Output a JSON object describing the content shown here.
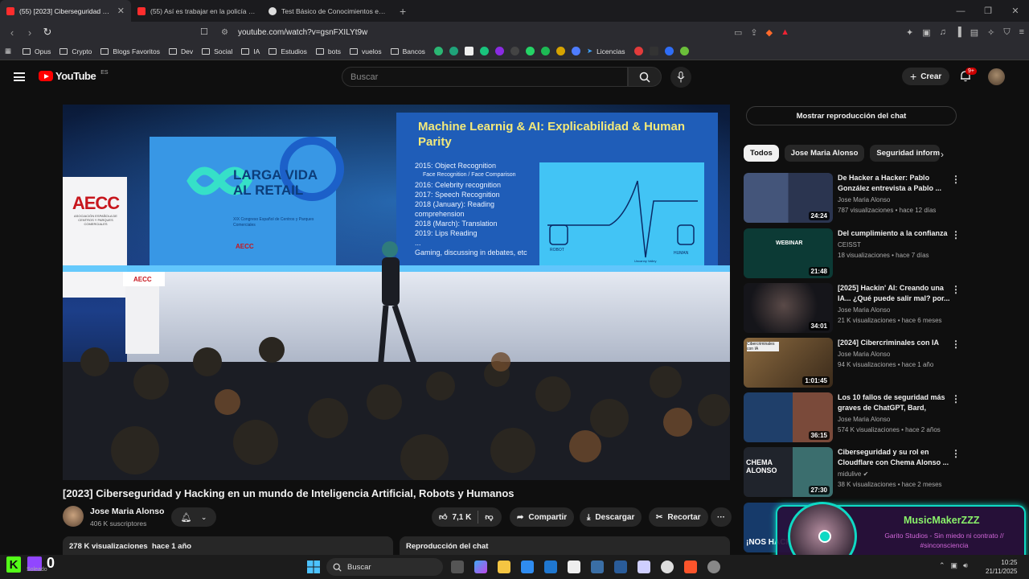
{
  "browser": {
    "tabs": [
      {
        "title": "(55) [2023] Ciberseguridad y Hacking",
        "favicon_color": "#ff2d2d",
        "active": true
      },
      {
        "title": "(55) Así es trabajar en la policía com",
        "favicon_color": "#ff2d2d",
        "active": false
      },
      {
        "title": "Test Básico de Conocimientos en Inst",
        "favicon_color": "#dddddd",
        "active": false
      }
    ],
    "url": "youtube.com/watch?v=gsnFXILYt9w",
    "bookmarks": [
      "Opus",
      "Crypto",
      "Blogs Favoritos",
      "Dev",
      "Social",
      "IA",
      "Estudios",
      "bots",
      "vuelos",
      "Bancos",
      "Licencias"
    ]
  },
  "youtube": {
    "logo": "YouTube",
    "region": "ES",
    "search_placeholder": "Buscar",
    "create_label": "Crear",
    "notif_count": "9+"
  },
  "video": {
    "title": "[2023] Ciberseguridad y Hacking en un mundo de Inteligencia Artificial, Robots y Humanos",
    "channel": "Jose Maria Alonso",
    "subscribers": "406 K suscriptores",
    "likes": "7,1 K",
    "share": "Compartir",
    "download": "Descargar",
    "clip": "Recortar",
    "views_line": "278 K visualizaciones  hace 1 año",
    "chat_replay": "Reproducción del chat",
    "slide_title": "Machine Learnig & AI: Explicabilidad & Human Parity",
    "slide_items": [
      "2015: Object Recognition",
      "Face Recognition / Face Comparison",
      "2016: Celebrity recognition",
      "2017: Speech Recognition",
      "2018 (January): Reading comprehension",
      "2018 (March): Translation",
      "2019: Lips Reading",
      "...",
      "Gaming, discussing in debates, etc"
    ],
    "left_screen_text": "LARGA VIDA AL RETAIL",
    "left_screen_sub": "XIX Congreso Español de Centros y Parques Comerciales",
    "org_logo": "AECC",
    "org_sub": "ASOCIACIÓN ESPAÑOLA DE CENTROS Y PARQUES COMERCIALES",
    "chart_labels": {
      "robot": "ROBOT",
      "valley": "Uncanny Valley",
      "human": "HUMAN"
    }
  },
  "sidebar": {
    "chat_button": "Mostrar reproducción del chat",
    "chips": [
      "Todos",
      "Jose Maria Alonso",
      "Seguridad informá"
    ],
    "recommendations": [
      {
        "title": "De Hacker a Hacker: Pablo González entrevista a Pablo ...",
        "channel": "Jose Maria Alonso",
        "meta": "787 visualizaciones • hace 12 días",
        "duration": "24:24",
        "thumb": "#3b4f7a"
      },
      {
        "title": "Del cumplimiento a la confianza",
        "channel": "CEISST",
        "meta": "18 visualizaciones • hace 7 días",
        "duration": "21:48",
        "thumb": "#0c3a35"
      },
      {
        "title": "[2025] Hackin' AI: Creando una IA... ¿Qué puede salir mal? por...",
        "channel": "Jose Maria Alonso",
        "meta": "21 K visualizaciones • hace 6 meses",
        "duration": "34:01",
        "thumb": "#1c1c24"
      },
      {
        "title": "[2024] Cibercriminales con IA",
        "channel": "Jose Maria Alonso",
        "meta": "94 K visualizaciones • hace 1 año",
        "duration": "1:01:45",
        "thumb": "#6f5a3b"
      },
      {
        "title": "Los 10 fallos de seguridad más graves de ChatGPT, Bard, Llam...",
        "channel": "Jose Maria Alonso",
        "meta": "574 K visualizaciones • hace 2 años",
        "duration": "36:15",
        "thumb": "#1f3f6a"
      },
      {
        "title": "Ciberseguridad y su rol en Cloudflare con Chema Alonso ...",
        "channel": "midulive",
        "meta": "38 K visualizaciones • hace 2 meses",
        "duration": "27:30",
        "thumb": "#20242c"
      },
      {
        "title": "",
        "channel": "",
        "meta": "",
        "duration": "",
        "thumb": "#163a6a"
      }
    ],
    "rec_thumb_texts": {
      "webinar": "WEBINAR",
      "chema": "CHEMA ALONSO",
      "cibercriminales": "Cibercriminales con IA",
      "hack": "¡NOS HACK"
    }
  },
  "overlay": {
    "name": "MusicMakerZZZ",
    "text": "Garito Studios - Sin miedo ni contrato // #sinconsciencia"
  },
  "taskbar": {
    "search": "Buscar",
    "time": "10:25",
    "date": "21/11/2025",
    "weather": "Soleado",
    "twitch_count": "0"
  }
}
